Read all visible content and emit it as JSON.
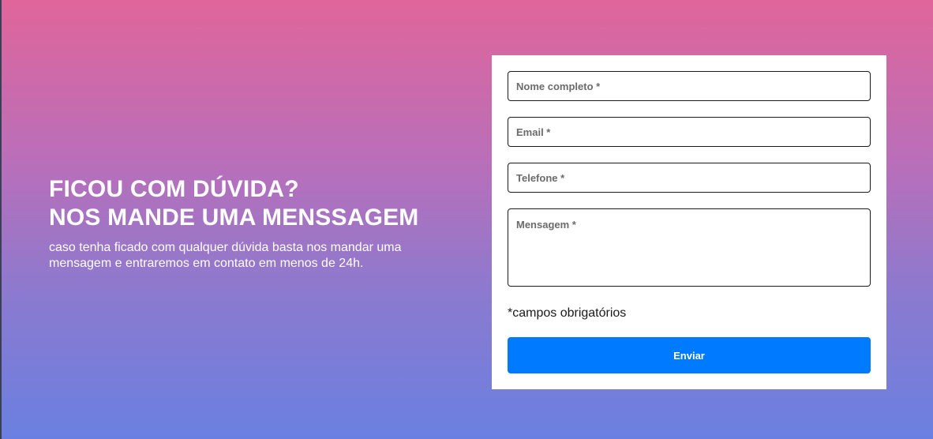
{
  "hero": {
    "title_line1": "FICOU COM DÚVIDA?",
    "title_line2": "NOS MANDE UMA MENSSAGEM",
    "subtitle": "caso tenha ficado com qualquer dúvida basta nos mandar uma mensagem e entraremos em contato em menos de 24h."
  },
  "form": {
    "name_placeholder": "Nome completo *",
    "email_placeholder": "Email *",
    "phone_placeholder": "Telefone *",
    "message_placeholder": "Mensagem *",
    "name_value": "",
    "email_value": "",
    "phone_value": "",
    "message_value": "",
    "required_note": "*campos obrigatórios",
    "submit_label": "Enviar"
  },
  "colors": {
    "gradient_top": "#e0659a",
    "gradient_bottom": "#6a80e0",
    "button": "#007bff",
    "card": "#ffffff"
  }
}
